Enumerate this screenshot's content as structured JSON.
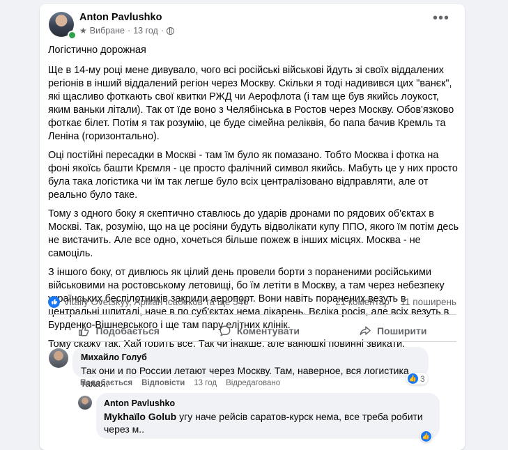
{
  "post": {
    "author": "Anton Pavlushko",
    "audience": "Вибране",
    "time": "13 год",
    "title_line": "Логістично дорожная",
    "paragraphs": [
      "Ще в 14-му році мене дивувало, чого всі російські військові йдуть зі своїх віддалених регіонів в інший віддалений регіон через Москву. Скільки я тоді надивився цих \"ванєк\", які щасливо фоткають свої квитки РЖД чи Аерофлота (і там ще був якийсь лоукост, яким ваньки літали). Так от їде воно з Челябінська в Ростов через Москву. Обов'язково фоткає білет. Потім я так розумію, це буде сімейна реліквія, бо папа бачив Кремль та Леніна (горизонтально).",
      "Оці постійні пересадки в Москві - там їм було як помазано. Тобто Москва і фотка на фоні якоїсь башти Крємля - це просто фалічний символ якийсь. Мабуть це у них просто була така логістика чи їм так легше було всіх централізовано відправляти, але от реально було таке.",
      "Тому з одного боку я скептично ставлюсь до ударів дронами по рядових об'єктах в Москві. Так, розумію, що на це росіяни будуть відволікати купу ППО, якого їм потім десь не вистачить. Але все одно, хочеться більше пожеж в інших місцях. Москва - не самоціль.",
      "З іншого боку, от дивлюсь як цілий день провели борти з пораненими російськими військовими на ростовському летовищі, бо їм летіти в Москву, а там через небезпеку українських беспілотників закрили аеропорт. Вони навіть поранених везуть в центральні шпиталі, наче в по суб'єктах нема лікарень. Вєліка росія, але всіх везуть в Бурденко-Вішневського і ще там пару елітних клінік.",
      "Тому скажу так. Хай горить все. Так чи інакше, але ванюшкі повинні звикати."
    ],
    "reactors": "Vitaliy Ovetskyy, Арман Ісабеков та ще 546",
    "comments_count": "21 коментар",
    "shares_count": "11 поширень"
  },
  "actions": {
    "like": "Подобається",
    "comment": "Коментувати",
    "share": "Поширити"
  },
  "comments": [
    {
      "author": "Михайло Голуб",
      "text": "Так они и по России летают через Москву. Там, наверное, вся логистика такая.",
      "like_label": "Подобається",
      "reply_label": "Відповісти",
      "time": "13 год",
      "edited": "Відредаговано",
      "reactions": "3"
    },
    {
      "author": "Anton Pavlushko",
      "mention": "Mykhaïlo Golub",
      "text_line1": " угу наче рейсів саратов-курск нема, все треба робити",
      "text_line2": "через м.."
    }
  ],
  "colors": {
    "accent": "#1877f2",
    "secondary_text": "#65676b",
    "background": "#f0f2f5",
    "online": "#31a24c"
  },
  "icons": {
    "audience": "star-icon",
    "privacy": "globe-icon",
    "more": "more-options-icon",
    "like": "thumbs-up-icon",
    "comment": "comment-bubble-icon",
    "share": "share-arrow-icon"
  }
}
